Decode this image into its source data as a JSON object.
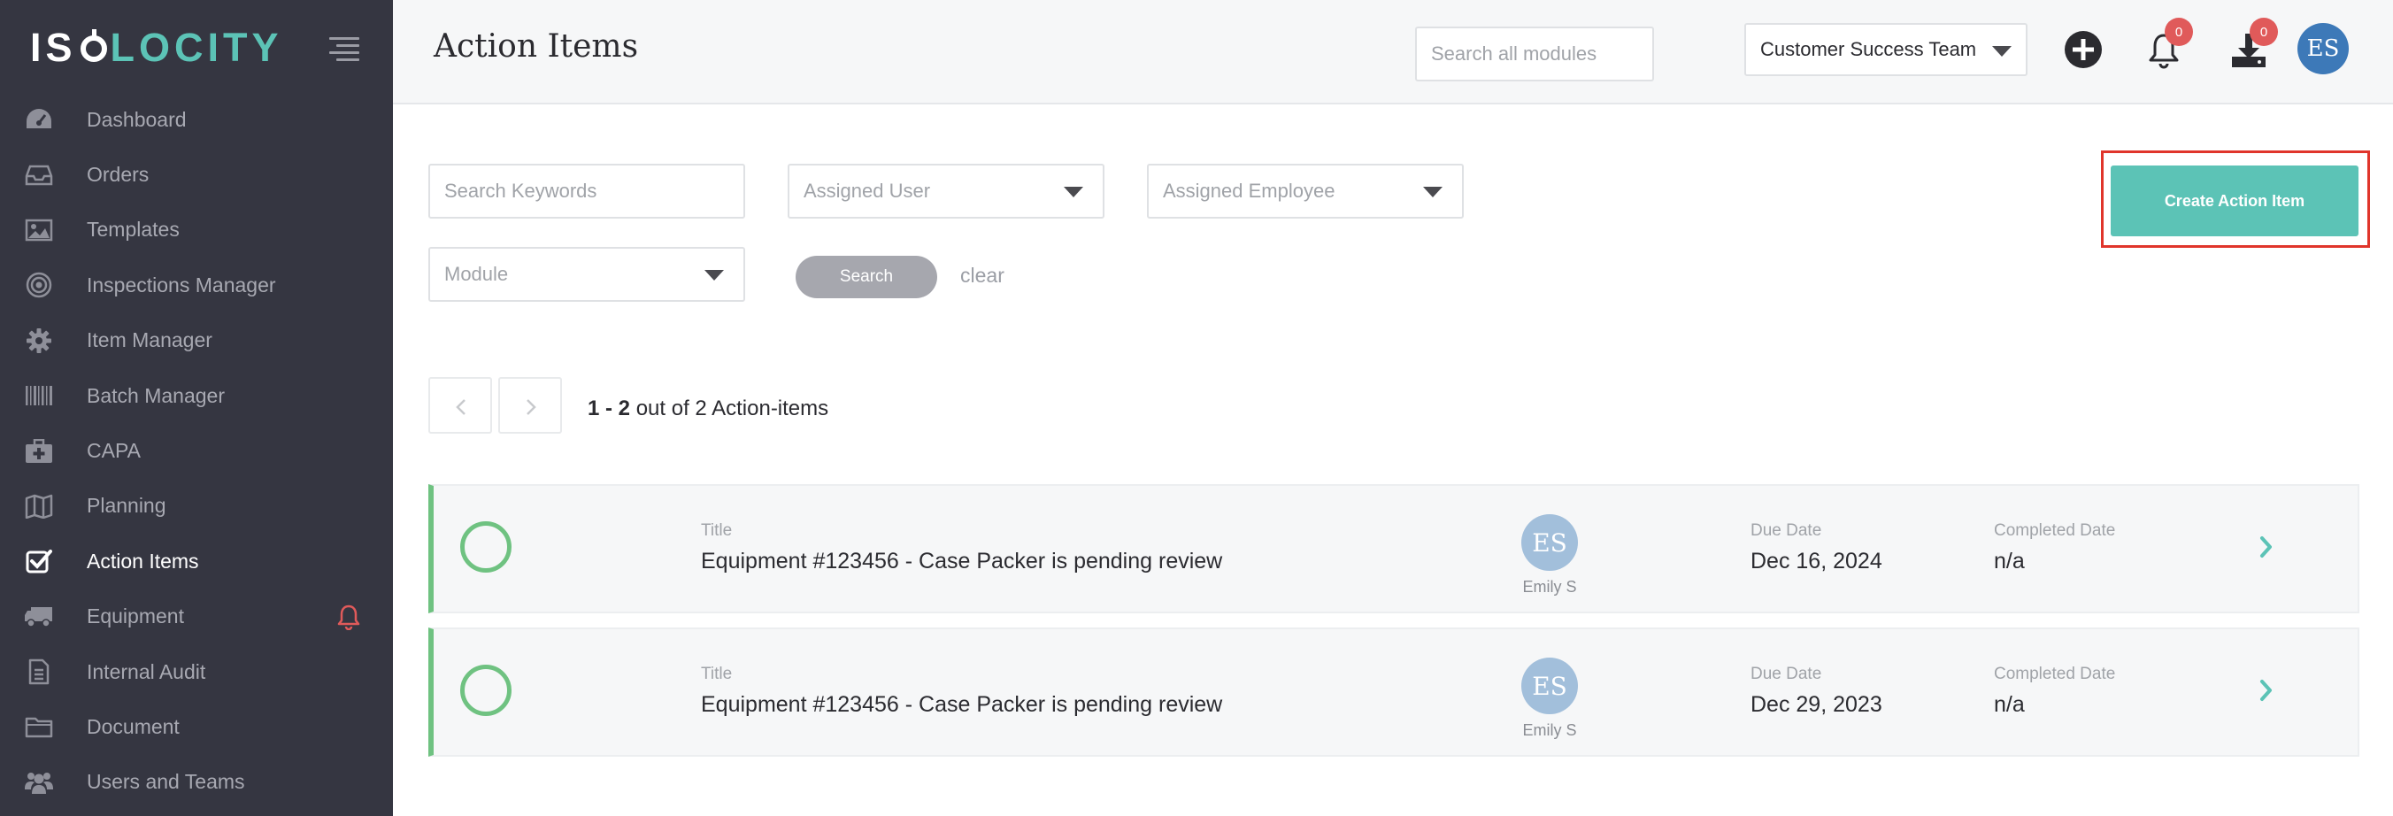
{
  "brand": {
    "logo_left": "IS",
    "logo_right": "LOCITY",
    "accent": "#5cc3b6"
  },
  "sidebar": {
    "items": [
      {
        "label": "Dashboard",
        "icon": "dashboard-gauge-icon"
      },
      {
        "label": "Orders",
        "icon": "inbox-tray-icon"
      },
      {
        "label": "Templates",
        "icon": "image-icon"
      },
      {
        "label": "Inspections Manager",
        "icon": "target-icon"
      },
      {
        "label": "Item Manager",
        "icon": "gear-icon"
      },
      {
        "label": "Batch Manager",
        "icon": "barcode-icon"
      },
      {
        "label": "CAPA",
        "icon": "first-aid-kit-icon"
      },
      {
        "label": "Planning",
        "icon": "map-icon"
      },
      {
        "label": "Action Items",
        "icon": "checkbox-icon",
        "active": true
      },
      {
        "label": "Equipment",
        "icon": "truck-icon",
        "alert_icon": "bell-alert-icon"
      },
      {
        "label": "Internal Audit",
        "icon": "document-icon"
      },
      {
        "label": "Document",
        "icon": "folder-icon"
      },
      {
        "label": "Users and Teams",
        "icon": "users-icon"
      }
    ]
  },
  "header": {
    "title": "Action Items",
    "search_placeholder": "Search all modules",
    "team": "Customer Success Team",
    "notifications_count": "0",
    "downloads_count": "0",
    "avatar_initials": "ES"
  },
  "filters": {
    "keywords_placeholder": "Search Keywords",
    "assigned_user": "Assigned User",
    "assigned_employee": "Assigned Employee",
    "module": "Module",
    "search_label": "Search",
    "clear_label": "clear",
    "create_label": "Create Action Item"
  },
  "pagination": {
    "range": "1 - 2",
    "summary": "out of 2 Action-items"
  },
  "action_items": [
    {
      "title_label": "Title",
      "title": "Equipment #123456 - Case Packer is pending review",
      "assignee_initials": "ES",
      "assignee_name": "Emily S",
      "due_label": "Due Date",
      "due_date": "Dec 16, 2024",
      "completed_label": "Completed Date",
      "completed_date": "n/a"
    },
    {
      "title_label": "Title",
      "title": "Equipment #123456 - Case Packer is pending review",
      "assignee_initials": "ES",
      "assignee_name": "Emily S",
      "due_label": "Due Date",
      "due_date": "Dec 29, 2023",
      "completed_label": "Completed Date",
      "completed_date": "n/a"
    }
  ],
  "colors": {
    "sidebar_bg": "#353641",
    "teal": "#5cc3b6",
    "status_green": "#6fc281",
    "badge_red": "#e05a5a",
    "highlight_red": "#e0352b"
  }
}
